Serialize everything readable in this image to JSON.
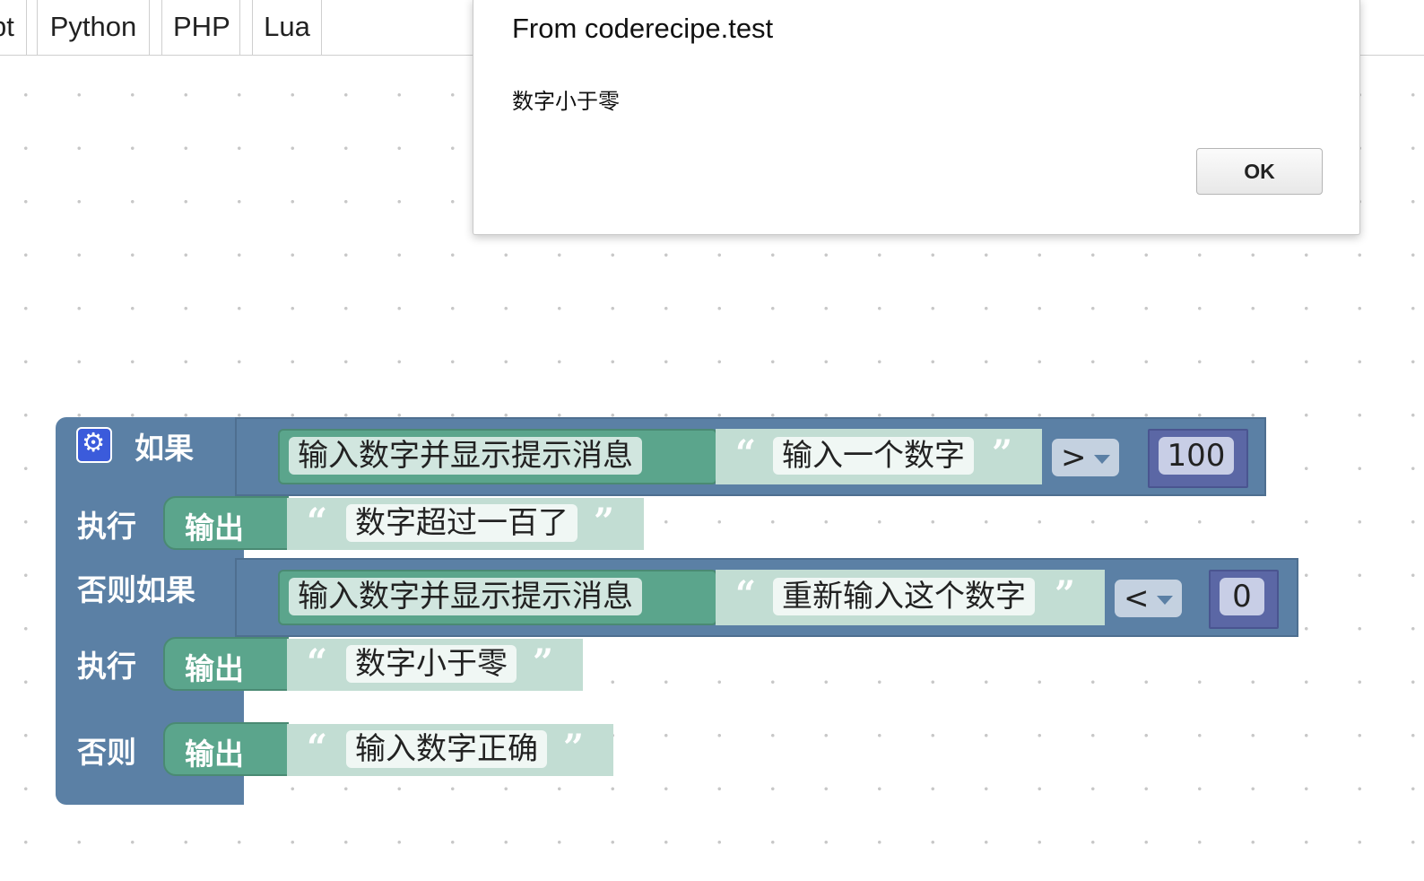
{
  "tabs": [
    {
      "label": "pt"
    },
    {
      "label": "Python"
    },
    {
      "label": "PHP"
    },
    {
      "label": "Lua"
    }
  ],
  "dialog": {
    "origin": "From coderecipe.test",
    "message": "数字小于零",
    "ok_label": "OK"
  },
  "blocks": {
    "if_label": "如果",
    "do1_label": "执行",
    "elseif_label": "否则如果",
    "do2_label": "执行",
    "else_label": "否则",
    "cond1": {
      "prompt_dropdown": "输入数字并显示提示消息",
      "prompt_text": "输入一个数字",
      "operator": ">",
      "number": "100"
    },
    "print1": {
      "label": "输出",
      "text": "数字超过一百了"
    },
    "cond2": {
      "prompt_dropdown": "输入数字并显示提示消息",
      "prompt_text": "重新输入这个数字",
      "operator": "<",
      "number": "0"
    },
    "print2": {
      "label": "输出",
      "text": "数字小于零"
    },
    "print3": {
      "label": "输出",
      "text": "输入数字正确"
    }
  },
  "colors": {
    "logic_block": "#5b80a5",
    "text_block": "#5ba58c",
    "math_block": "#5b67a5",
    "gear_icon": "#3b5bdb"
  }
}
